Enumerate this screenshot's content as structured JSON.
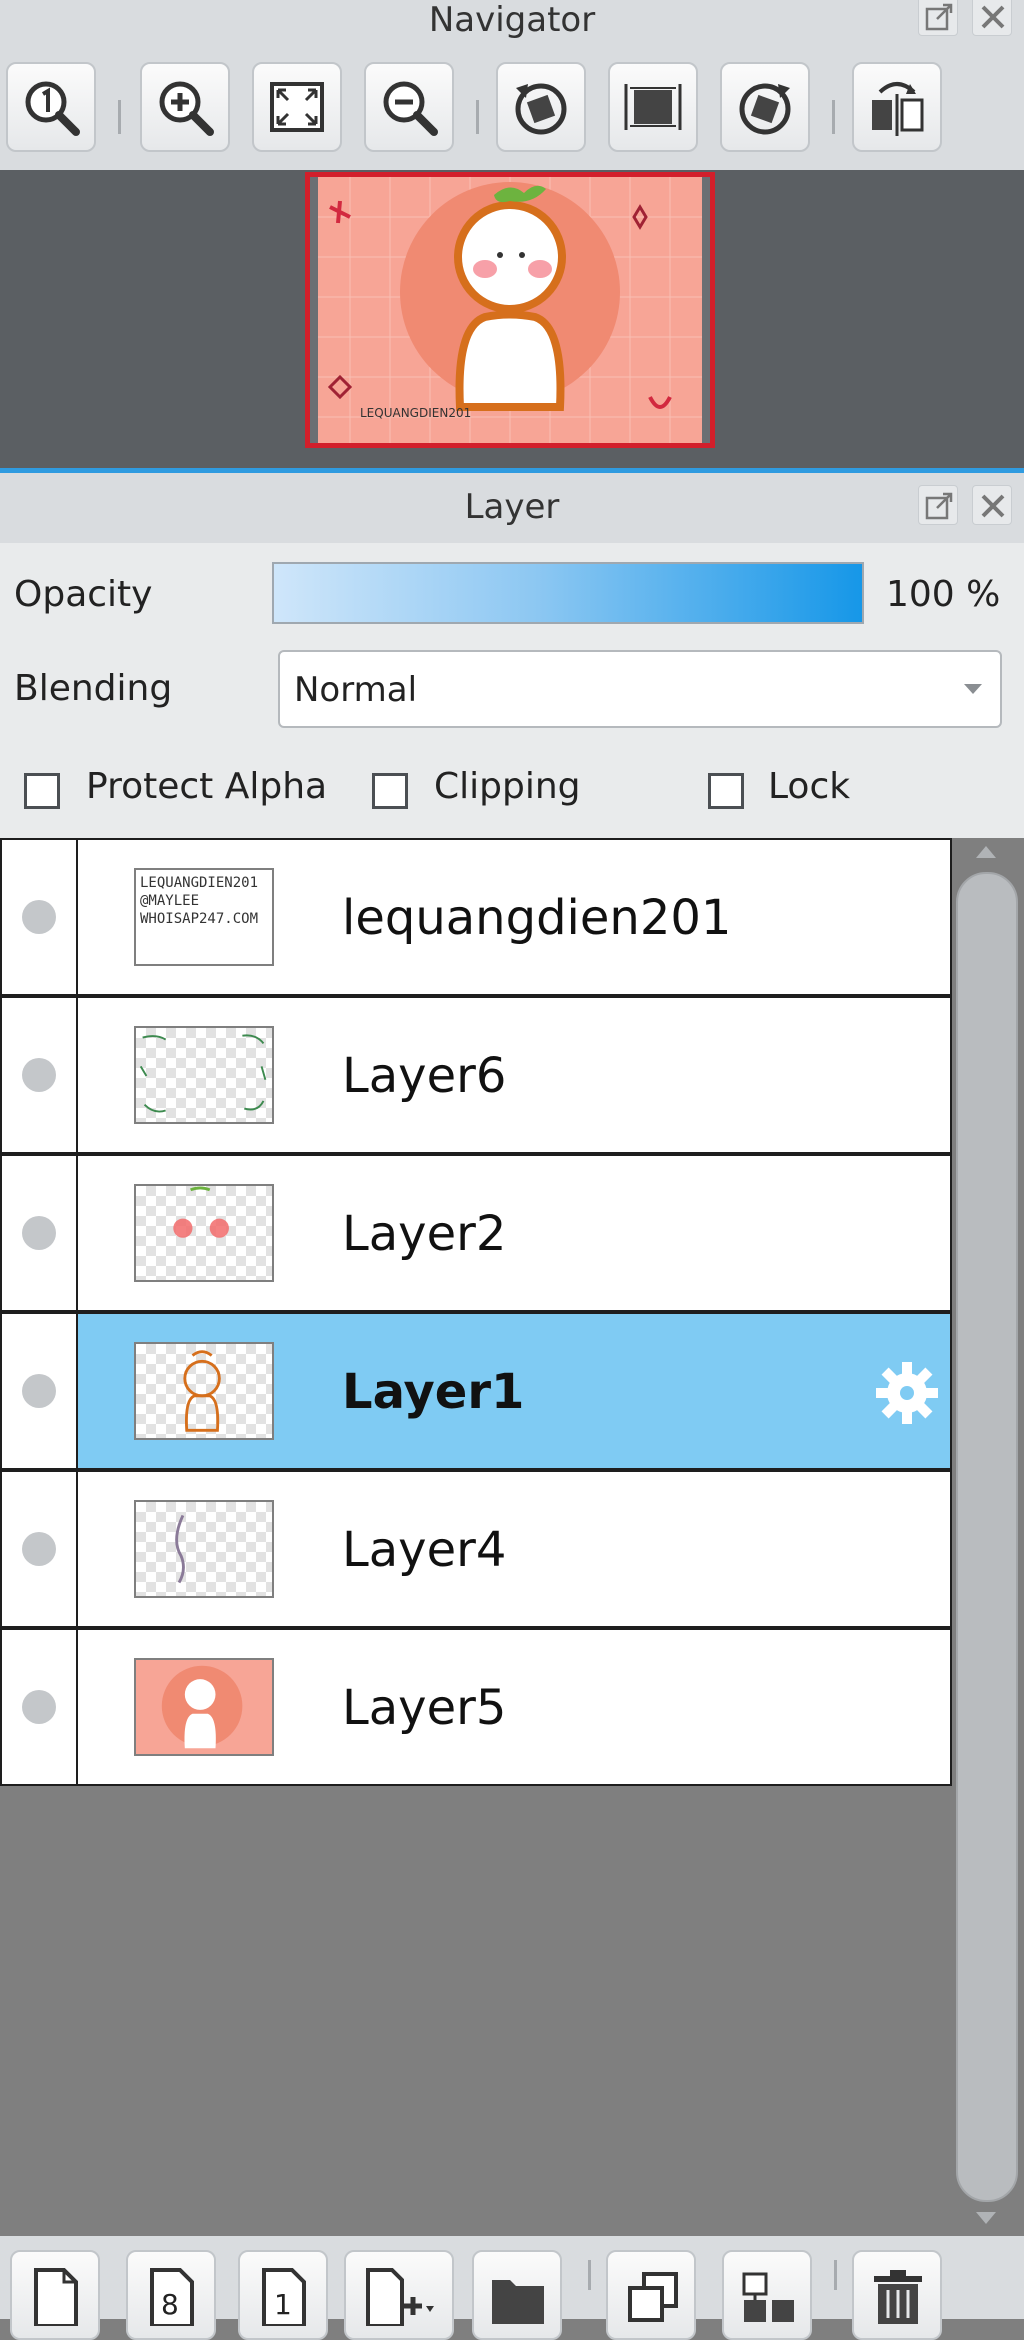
{
  "navigator": {
    "title": "Navigator",
    "toolbar": [
      {
        "name": "zoom-actual-button",
        "icon": "zoom-1-icon"
      },
      {
        "name": "zoom-in-button",
        "icon": "zoom-in-icon"
      },
      {
        "name": "fit-window-button",
        "icon": "fit-icon"
      },
      {
        "name": "zoom-out-button",
        "icon": "zoom-out-icon"
      },
      {
        "name": "rotate-left-button",
        "icon": "rotate-left-icon"
      },
      {
        "name": "reset-view-button",
        "icon": "reset-icon"
      },
      {
        "name": "rotate-right-button",
        "icon": "rotate-right-icon"
      },
      {
        "name": "flip-horizontal-button",
        "icon": "flip-icon"
      }
    ]
  },
  "layer_panel": {
    "title": "Layer",
    "opacity_label": "Opacity",
    "opacity_value": "100 %",
    "opacity_percent": 100,
    "blending_label": "Blending",
    "blending_value": "Normal",
    "protect_alpha_label": "Protect Alpha",
    "clipping_label": "Clipping",
    "lock_label": "Lock",
    "protect_alpha_checked": false,
    "clipping_checked": false,
    "lock_checked": false
  },
  "layers": [
    {
      "name": "lequangdien201",
      "selected": false,
      "thumb_text": [
        "LEQUANGDIEN201",
        "@MAYLEE",
        "WHOISAP247.COM"
      ]
    },
    {
      "name": "Layer6",
      "selected": false
    },
    {
      "name": "Layer2",
      "selected": false
    },
    {
      "name": "Layer1",
      "selected": true
    },
    {
      "name": "Layer4",
      "selected": false
    },
    {
      "name": "Layer5",
      "selected": false
    }
  ],
  "bottom_toolbar": [
    {
      "name": "new-layer-button",
      "icon": "page-icon",
      "label": ""
    },
    {
      "name": "new-8bit-layer-button",
      "icon": "page-8-icon",
      "label": "8"
    },
    {
      "name": "new-1bit-layer-button",
      "icon": "page-1-icon",
      "label": "1"
    },
    {
      "name": "add-layer-dropdown-button",
      "icon": "add-page-icon",
      "label": ""
    },
    {
      "name": "new-folder-button",
      "icon": "folder-icon",
      "label": ""
    },
    {
      "name": "duplicate-layer-button",
      "icon": "duplicate-icon",
      "label": ""
    },
    {
      "name": "merge-down-button",
      "icon": "merge-icon",
      "label": ""
    },
    {
      "name": "delete-layer-button",
      "icon": "trash-icon",
      "label": ""
    }
  ],
  "colors": {
    "selected_row": "#7fcbf3",
    "navigator_frame": "#d21f2b",
    "accent_blue": "#1697e8"
  }
}
